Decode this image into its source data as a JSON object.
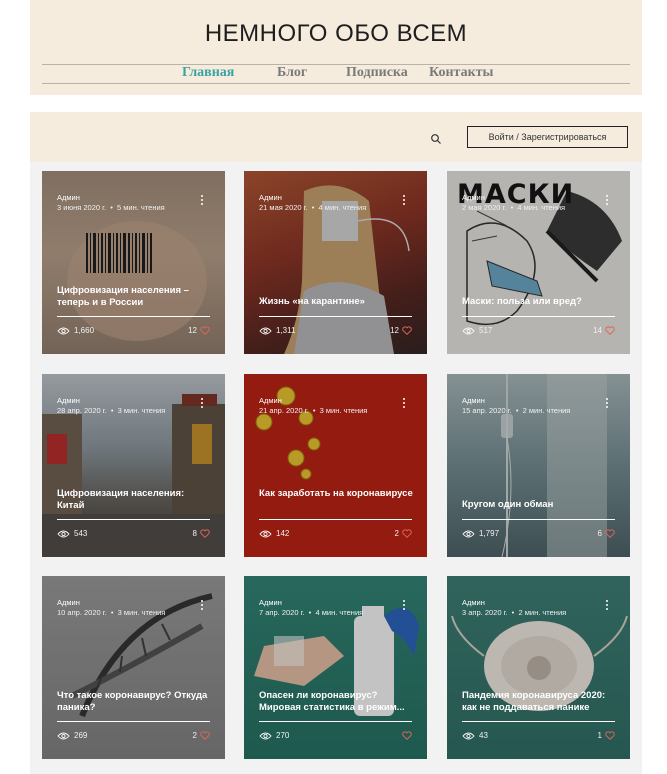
{
  "site": {
    "title": "НЕМНОГО ОБО ВСЕМ"
  },
  "nav": [
    {
      "label": "Главная",
      "active": true
    },
    {
      "label": "Блог",
      "active": false
    },
    {
      "label": "Подписка",
      "active": false
    },
    {
      "label": "Контакты",
      "active": false
    }
  ],
  "blog_bar": {
    "login_label": "Войти / Зарегистрироваться",
    "search_icon": "search-icon"
  },
  "posts": [
    {
      "author": "Админ",
      "date": "3 июня 2020 г.",
      "read_time": "5 мин. чтения",
      "title": "Цифровизация населения – теперь и в России",
      "views": "1,660",
      "likes": "12"
    },
    {
      "author": "Админ",
      "date": "21 мая 2020 г.",
      "read_time": "4 мин. чтения",
      "title": "Жизнь «на карантине»",
      "views": "1,311",
      "likes": "12"
    },
    {
      "author": "Админ",
      "date": "2 мая 2020 г.",
      "read_time": "4 мин. чтения",
      "title": "Маски: польза или вред?",
      "views": "517",
      "likes": "14",
      "overlay_text": "МАСКИ"
    },
    {
      "author": "Админ",
      "date": "28 апр. 2020 г.",
      "read_time": "3 мин. чтения",
      "title": "Цифровизация населения: Китай",
      "views": "543",
      "likes": "8"
    },
    {
      "author": "Админ",
      "date": "21 апр. 2020 г.",
      "read_time": "3 мин. чтения",
      "title": "Как заработать на коронавирусе",
      "views": "142",
      "likes": "2"
    },
    {
      "author": "Админ",
      "date": "15 апр. 2020 г.",
      "read_time": "2 мин. чтения",
      "title": "Кругом один обман",
      "views": "1,797",
      "likes": "6"
    },
    {
      "author": "Админ",
      "date": "10 апр. 2020 г.",
      "read_time": "3 мин. чтения",
      "title": "Что такое коронавирус? Откуда паника?",
      "views": "269",
      "likes": "2"
    },
    {
      "author": "Админ",
      "date": "7 апр. 2020 г.",
      "read_time": "4 мин. чтения",
      "title": "Опасен ли коронавирус? Мировая статистика в режим...",
      "views": "270",
      "likes": ""
    },
    {
      "author": "Админ",
      "date": "3 апр. 2020 г.",
      "read_time": "2 мин. чтения",
      "title": "Пандемия коронавируса 2020: как не поддаваться панике",
      "views": "43",
      "likes": "1"
    }
  ],
  "colors": {
    "header_bg": "#f6ecdd",
    "nav_active": "#3aa3a0",
    "nav_inactive": "#7a7a7a",
    "like_heart": "#e0645c"
  }
}
